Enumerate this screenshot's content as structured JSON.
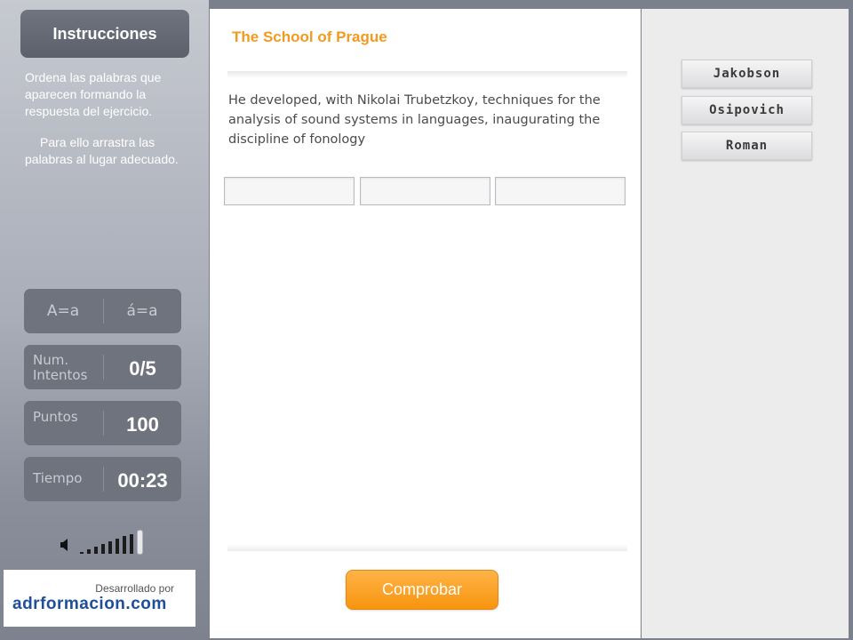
{
  "sidebar": {
    "instructions_title": "Instrucciones",
    "instructions_p1": "Ordena las palabras que aparecen formando la respuesta del ejercicio.",
    "instructions_p2": "Para ello arrastra las palabras al lugar adecuado.",
    "case_options": [
      "A=a",
      "á=a"
    ],
    "attempts": {
      "label": "Num. Intentos",
      "value": "0/5"
    },
    "points": {
      "label": "Puntos",
      "value": "100"
    },
    "time": {
      "label": "Tiempo",
      "value": "00:23"
    },
    "volume": {
      "icon": "speaker-icon",
      "bars": 7
    },
    "credit": {
      "by": "Desarrollado por",
      "brand": "adrformacion.com"
    }
  },
  "exercise": {
    "title": "The School of Prague",
    "question": "He developed, with Nikolai Trubetzkoy, techniques for the analysis of sound systems in languages, inaugurating the discipline of fonology",
    "slots": [
      "",
      "",
      ""
    ],
    "check_label": "Comprobar"
  },
  "word_bank": [
    "Jakobson",
    "Osipovich",
    "Roman"
  ],
  "colors": {
    "accent": "#f39a1e",
    "button": "#f7940f",
    "sidebar": "#8a8f9b",
    "brand": "#1e4f9a"
  }
}
